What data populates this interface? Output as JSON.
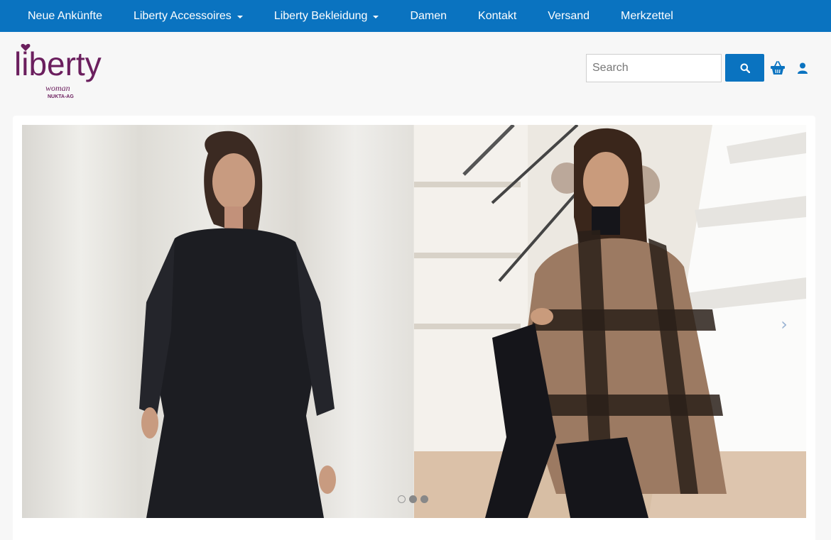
{
  "nav": {
    "items": [
      {
        "label": "Neue Ankünfte",
        "dropdown": false
      },
      {
        "label": "Liberty Accessoires",
        "dropdown": true
      },
      {
        "label": "Liberty Bekleidung",
        "dropdown": true
      },
      {
        "label": "Damen",
        "dropdown": false
      },
      {
        "label": "Kontakt",
        "dropdown": false
      },
      {
        "label": "Versand",
        "dropdown": false
      },
      {
        "label": "Merkzettel",
        "dropdown": false
      }
    ]
  },
  "logo": {
    "brand": "liberty",
    "sub1": "woman",
    "sub2": "NUKTA-AG"
  },
  "search": {
    "placeholder": "Search",
    "value": ""
  },
  "icons": {
    "search": "search-icon",
    "basket": "basket-icon",
    "user": "user-icon",
    "next": "chevron-right-icon"
  },
  "carousel": {
    "next_glyph": "›",
    "slide_count": 3,
    "active_index": 1
  },
  "colors": {
    "nav_bg": "#0a73c0",
    "accent": "#0a73c0",
    "brand_purple": "#6b1f5e"
  }
}
